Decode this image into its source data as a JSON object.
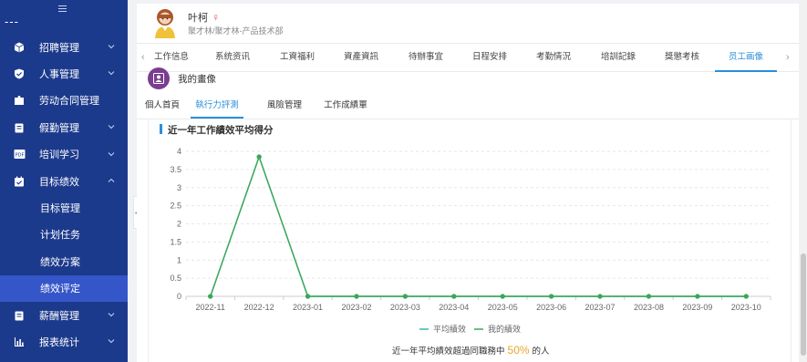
{
  "sidebar": {
    "top_label": "---",
    "items": [
      {
        "label": "招聘管理",
        "icon": "cube-icon",
        "expandable": true
      },
      {
        "label": "人事管理",
        "icon": "shield-check-icon",
        "expandable": true
      },
      {
        "label": "劳动合同管理",
        "icon": "puzzle-icon",
        "expandable": false
      },
      {
        "label": "假勤管理",
        "icon": "clipboard-icon",
        "expandable": true
      },
      {
        "label": "培训学习",
        "icon": "pdf-icon",
        "expandable": true
      },
      {
        "label": "目标绩效",
        "icon": "calendar-check-icon",
        "expandable": true,
        "expanded": true
      }
    ],
    "subitems": [
      {
        "label": "目标管理",
        "active": false
      },
      {
        "label": "计划任务",
        "active": false
      },
      {
        "label": "绩效方案",
        "active": false
      },
      {
        "label": "绩效评定",
        "active": true
      }
    ],
    "items_after": [
      {
        "label": "薪酬管理",
        "icon": "clipboard-icon",
        "expandable": true
      },
      {
        "label": "报表统计",
        "icon": "bar-chart-icon",
        "expandable": true
      }
    ]
  },
  "user": {
    "name": "叶柯",
    "gender_symbol": "♀",
    "department": "聚才林/聚才林-产品技术部"
  },
  "tabs": [
    "工作信息",
    "系统资讯",
    "工資福利",
    "資產資訊",
    "待辦事宜",
    "日程安排",
    "考勤情況",
    "培訓記錄",
    "獎懲考核",
    "员工画像"
  ],
  "active_tab": "员工画像",
  "portrait_title": "我的畫像",
  "subtabs": [
    "個人首頁",
    "執行力評測",
    "風險管理",
    "工作成績單"
  ],
  "active_subtab": "執行力評測",
  "chart_data": {
    "type": "line",
    "title": "近一年工作績效平均得分",
    "categories": [
      "2022-11",
      "2022-12",
      "2023-01",
      "2023-02",
      "2023-03",
      "2023-04",
      "2023-05",
      "2023-06",
      "2023-07",
      "2023-08",
      "2023-09",
      "2023-10"
    ],
    "series": [
      {
        "name": "平均績效",
        "color": "#3ab7a4",
        "values": [
          0,
          3.85,
          0,
          0,
          0,
          0,
          0,
          0,
          0,
          0,
          0,
          0
        ]
      },
      {
        "name": "我的績效",
        "color": "#3aa757",
        "values": [
          0,
          3.85,
          0,
          0,
          0,
          0,
          0,
          0,
          0,
          0,
          0,
          0
        ]
      }
    ],
    "ylim": [
      0,
      4
    ],
    "yticks": [
      "0",
      "0.5",
      "1",
      "1.5",
      "2",
      "2.5",
      "3",
      "3.5",
      "4"
    ],
    "grid": true,
    "legend_position": "bottom"
  },
  "summary": {
    "prefix": "近一年平均績效超過同職務中",
    "percent": "50%",
    "suffix": "的人"
  }
}
